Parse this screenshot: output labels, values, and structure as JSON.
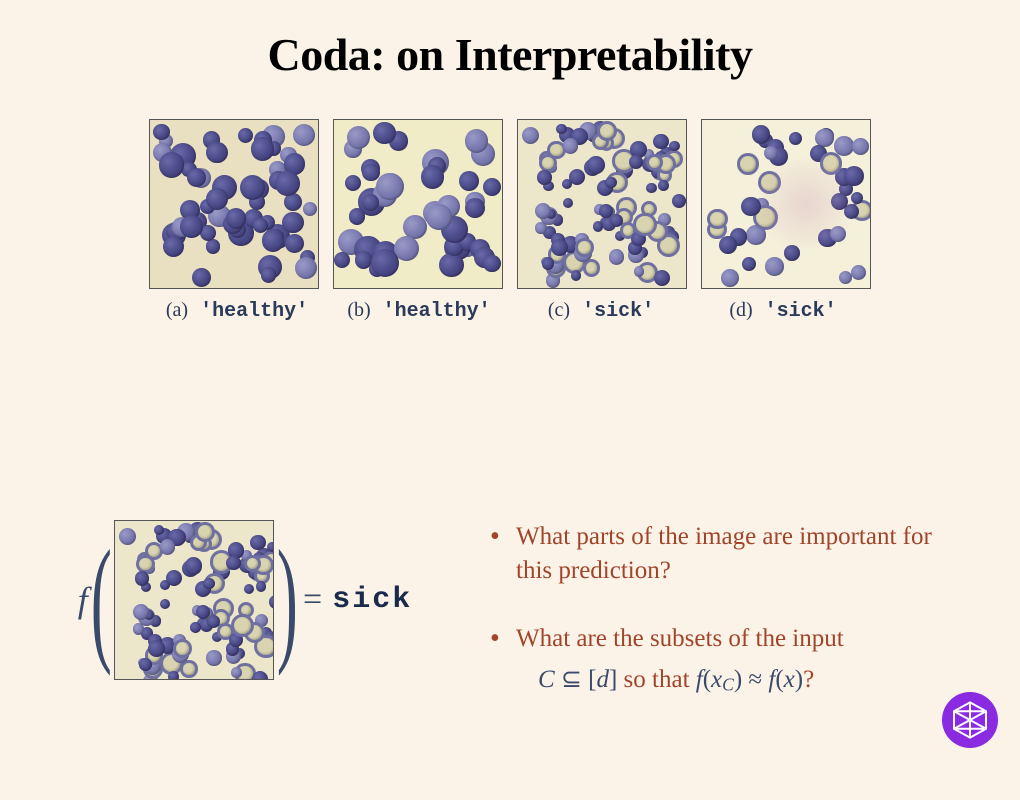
{
  "title": "Coda: on Interpretability",
  "panels": [
    {
      "id": "a",
      "label": "(a)",
      "value": "'healthy'"
    },
    {
      "id": "b",
      "label": "(b)",
      "value": "'healthy'"
    },
    {
      "id": "c",
      "label": "(c)",
      "value": "'sick'"
    },
    {
      "id": "d",
      "label": "(d)",
      "value": "'sick'"
    }
  ],
  "formula": {
    "fn": "f",
    "result": "sick"
  },
  "bullets": {
    "b1": "What parts of the image are important for this prediction?",
    "b2": "What are the subsets of the input",
    "mathline_plain": "C ⊆ [d] so that  f(x_C) ≈ f(x)?"
  },
  "colors": {
    "background": "#fcf3e8",
    "bullet_text": "#a0452a",
    "math_text": "#3a4a6a",
    "logo": "#8a2be2"
  },
  "chart_data": {
    "type": "table",
    "description": "Four microscopy blood-smear thumbnails labeled by class, and a classifier output f(image) = sick",
    "rows": [
      {
        "panel": "a",
        "class": "healthy"
      },
      {
        "panel": "b",
        "class": "healthy"
      },
      {
        "panel": "c",
        "class": "sick"
      },
      {
        "panel": "d",
        "class": "sick"
      }
    ]
  }
}
